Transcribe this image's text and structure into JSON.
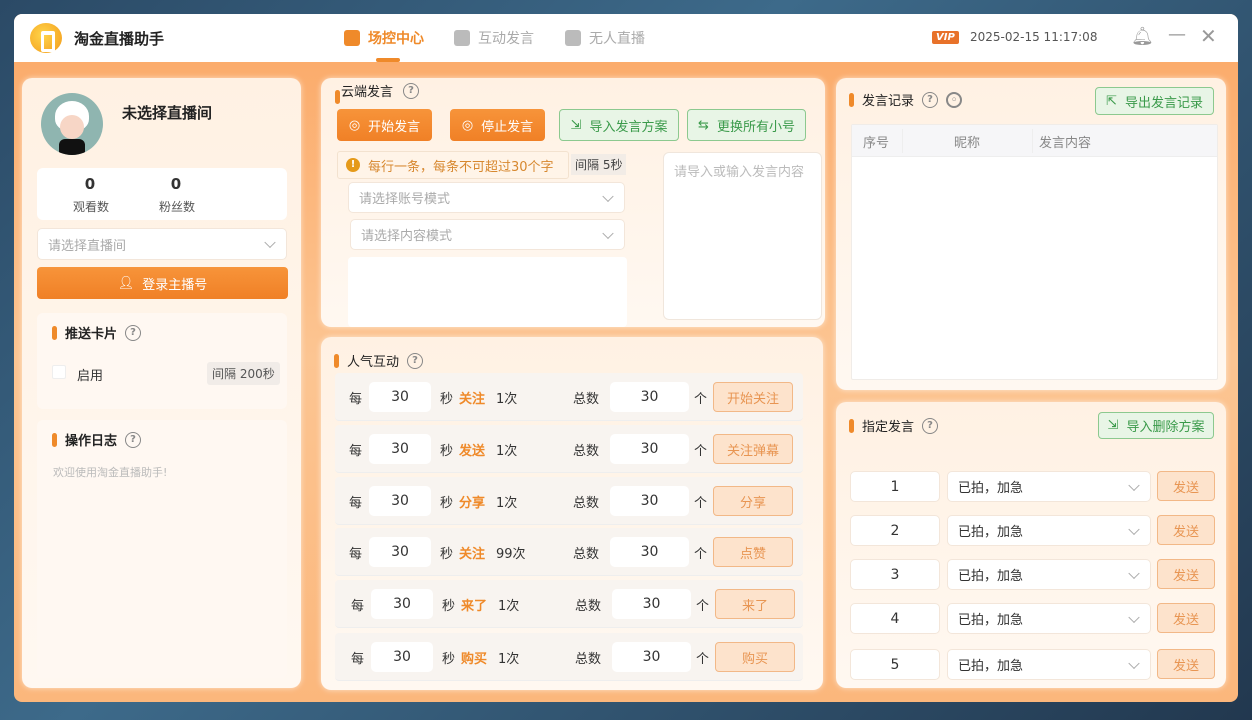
{
  "header": {
    "app_title": "淘金直播助手",
    "tabs": [
      {
        "label": "场控中心",
        "active": true
      },
      {
        "label": "互动发言"
      },
      {
        "label": "无人直播"
      }
    ],
    "vip": "VIP",
    "datetime": "2025-02-15 11:17:08"
  },
  "left": {
    "room_title": "未选择直播间",
    "stats": [
      {
        "value": "0",
        "label": "观看数"
      },
      {
        "value": "0",
        "label": "粉丝数"
      }
    ],
    "room_select_placeholder": "请选择直播间",
    "login_button": "登录主播号",
    "push_card": {
      "title": "推送卡片",
      "enable_label": "启用",
      "interval": "间隔 200秒"
    },
    "log": {
      "title": "操作日志",
      "message": "欢迎使用淘金直播助手!"
    }
  },
  "cloud": {
    "title": "云端发言",
    "start": "开始发言",
    "stop": "停止发言",
    "import": "导入发言方案",
    "switch": "更换所有小号",
    "tip": "每行一条，每条不可超过30个字",
    "interval": "间隔 5秒",
    "account_mode_placeholder": "请选择账号模式",
    "content_mode_placeholder": "请选择内容模式",
    "content_placeholder": "请导入或输入发言内容"
  },
  "interaction": {
    "title": "人气互动",
    "every": "每",
    "sec": "秒",
    "total": "总数",
    "unit": "个",
    "rows": [
      {
        "interval": "30",
        "action": "关注",
        "times": "1次",
        "total": "30",
        "button": "开始关注"
      },
      {
        "interval": "30",
        "action": "发送",
        "times": "1次",
        "total": "30",
        "button": "关注弹幕"
      },
      {
        "interval": "30",
        "action": "分享",
        "times": "1次",
        "total": "30",
        "button": "分享"
      },
      {
        "interval": "30",
        "action": "关注",
        "times": "99次",
        "total": "30",
        "button": "点赞"
      },
      {
        "interval": "30",
        "action": "来了",
        "times": "1次",
        "total": "30",
        "button": "来了"
      },
      {
        "interval": "30",
        "action": "购买",
        "times": "1次",
        "total": "30",
        "button": "购买"
      }
    ]
  },
  "record": {
    "title": "发言记录",
    "export": "导出发言记录",
    "columns": [
      "序号",
      "昵称",
      "发言内容"
    ]
  },
  "designated": {
    "title": "指定发言",
    "import": "导入删除方案",
    "rows": [
      {
        "num": "1",
        "content": "已拍，加急",
        "send": "发送"
      },
      {
        "num": "2",
        "content": "已拍，加急",
        "send": "发送"
      },
      {
        "num": "3",
        "content": "已拍，加急",
        "send": "发送"
      },
      {
        "num": "4",
        "content": "已拍，加急",
        "send": "发送"
      },
      {
        "num": "5",
        "content": "已拍，加急",
        "send": "发送"
      }
    ]
  },
  "colors": {
    "accent": "#ef8a2a",
    "green": "#3a9a4a"
  }
}
